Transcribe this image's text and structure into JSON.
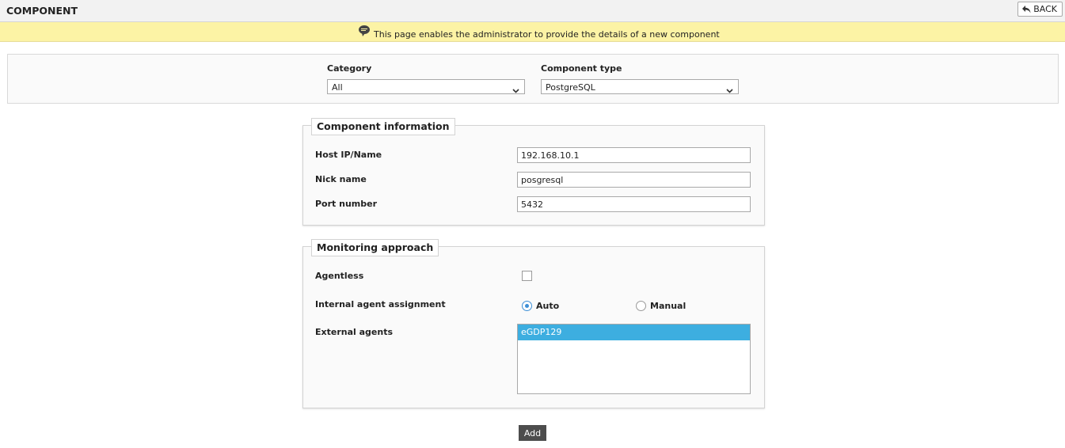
{
  "header": {
    "title": "COMPONENT",
    "back_label": "BACK"
  },
  "info": {
    "message": "This page enables the administrator to provide the details of a new component"
  },
  "filters": {
    "category": {
      "label": "Category",
      "value": "All"
    },
    "component_type": {
      "label": "Component type",
      "value": "PostgreSQL"
    }
  },
  "component_info": {
    "legend": "Component information",
    "host": {
      "label": "Host IP/Name",
      "value": "192.168.10.1"
    },
    "nick": {
      "label": "Nick name",
      "value": "posgresql"
    },
    "port": {
      "label": "Port number",
      "value": "5432"
    }
  },
  "monitoring": {
    "legend": "Monitoring approach",
    "agentless_label": "Agentless",
    "agentless_checked": false,
    "internal_label": "Internal agent assignment",
    "auto_label": "Auto",
    "manual_label": "Manual",
    "selected_assignment": "Auto",
    "external_label": "External agents",
    "external_agents": [
      "eGDP129"
    ]
  },
  "actions": {
    "add_label": "Add"
  },
  "colors": {
    "info_bar": "#fcf3a5",
    "selected_item": "#3daee0",
    "radio_accent": "#3d8fd6",
    "add_button": "#4d4d4d"
  }
}
